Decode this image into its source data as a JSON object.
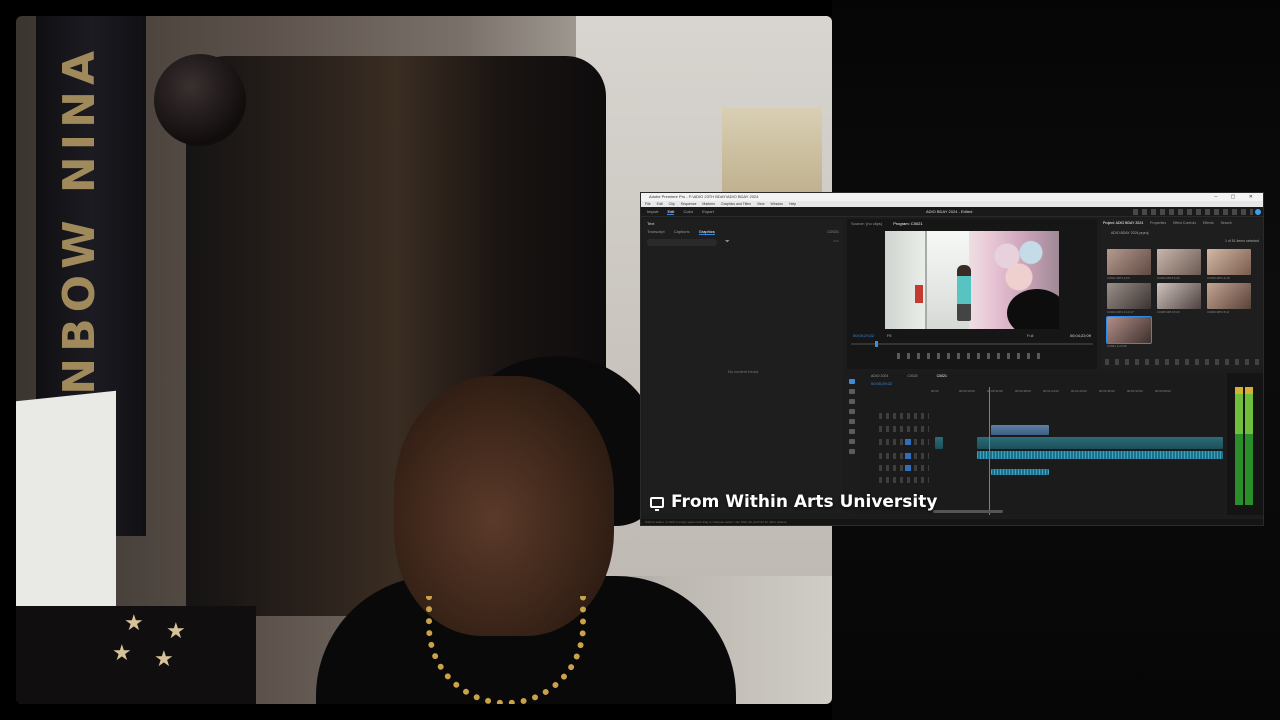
{
  "premiere": {
    "titlebar": "Adobe Premiere Pro - F:\\ADIO 23TH BDAY\\ADIO BDAY 2024",
    "menu": [
      "File",
      "Edit",
      "Clip",
      "Sequence",
      "Markers",
      "Graphics and Titles",
      "View",
      "Window",
      "Help"
    ],
    "workspace_tabs": [
      "Import",
      "Edit",
      "Color",
      "Export"
    ],
    "workspace_active": "Edit",
    "project_title": "ADIO BDAY 2024 - Edited",
    "left_panel": {
      "title": "Text",
      "tabs": [
        "Transcript",
        "Captions",
        "Graphics"
      ],
      "active_tab": "Graphics",
      "clip_code": "C0021",
      "empty_message": "No content found"
    },
    "monitor": {
      "tabs": [
        "Source: (no clips)",
        "Program: C0021"
      ],
      "active_tab": "Program: C0021",
      "timecode_in": "00;00;29;22",
      "fit": "Fit",
      "quality": "Full",
      "timecode_out": "00;04;22;09"
    },
    "project": {
      "tabs": [
        "Project: ADIO BDAY 2024",
        "Properties",
        "Effect Controls",
        "Effects",
        "Search"
      ],
      "active_tab": "Project: ADIO BDAY 2024",
      "path": "ADIO BDAY 2024.prproj",
      "count": "1 of 51 items selected",
      "thumbs": [
        {
          "label": "C0021.MP4",
          "duration": "2;23",
          "c1": "#b69a8e",
          "c2": "#5e4a44"
        },
        {
          "label": "C0022.MP4",
          "duration": "5;06",
          "c1": "#c9b7ad",
          "c2": "#6b5a52"
        },
        {
          "label": "C0023.MP4",
          "duration": "4;18",
          "c1": "#d2b8a5",
          "c2": "#7a5c4d"
        },
        {
          "label": "C0024.MP4",
          "duration": "2;14;17",
          "c1": "#9a8f8a",
          "c2": "#3a3331"
        },
        {
          "label": "C0025.MP4",
          "duration": "8;23",
          "c1": "#cfc3bd",
          "c2": "#4d4240"
        },
        {
          "label": "C0026.MP4",
          "duration": "6;11",
          "c1": "#c5a493",
          "c2": "#584238"
        },
        {
          "label": "C0021",
          "duration": "4;24;09",
          "c1": "#b28f87",
          "c2": "#3e2f2d"
        }
      ]
    },
    "timeline": {
      "tabs": [
        "ADIO 2024",
        "C0024",
        "C0021"
      ],
      "active_tab": "C0021",
      "timecode": "00;00;29;22",
      "ruler": [
        "00;00",
        "00;00;16;00",
        "00;00;32;00",
        "00;00;48;00",
        "00;01;04;02",
        "00;01;20;02",
        "00;01;36;02",
        "00;01;52;02",
        "00;02;08;04"
      ],
      "clip_labels": [
        "C0024.MP4",
        "C0021.MP4"
      ]
    },
    "status": "Click to select, or click in empty space and drag to marquee select. Use Shift, Alt, and Ctrl for other options."
  },
  "caption": {
    "text": "From Within Arts University",
    "icon": "monitor-icon"
  },
  "webcam": {
    "banner_text": "RAINBOW NINA"
  }
}
